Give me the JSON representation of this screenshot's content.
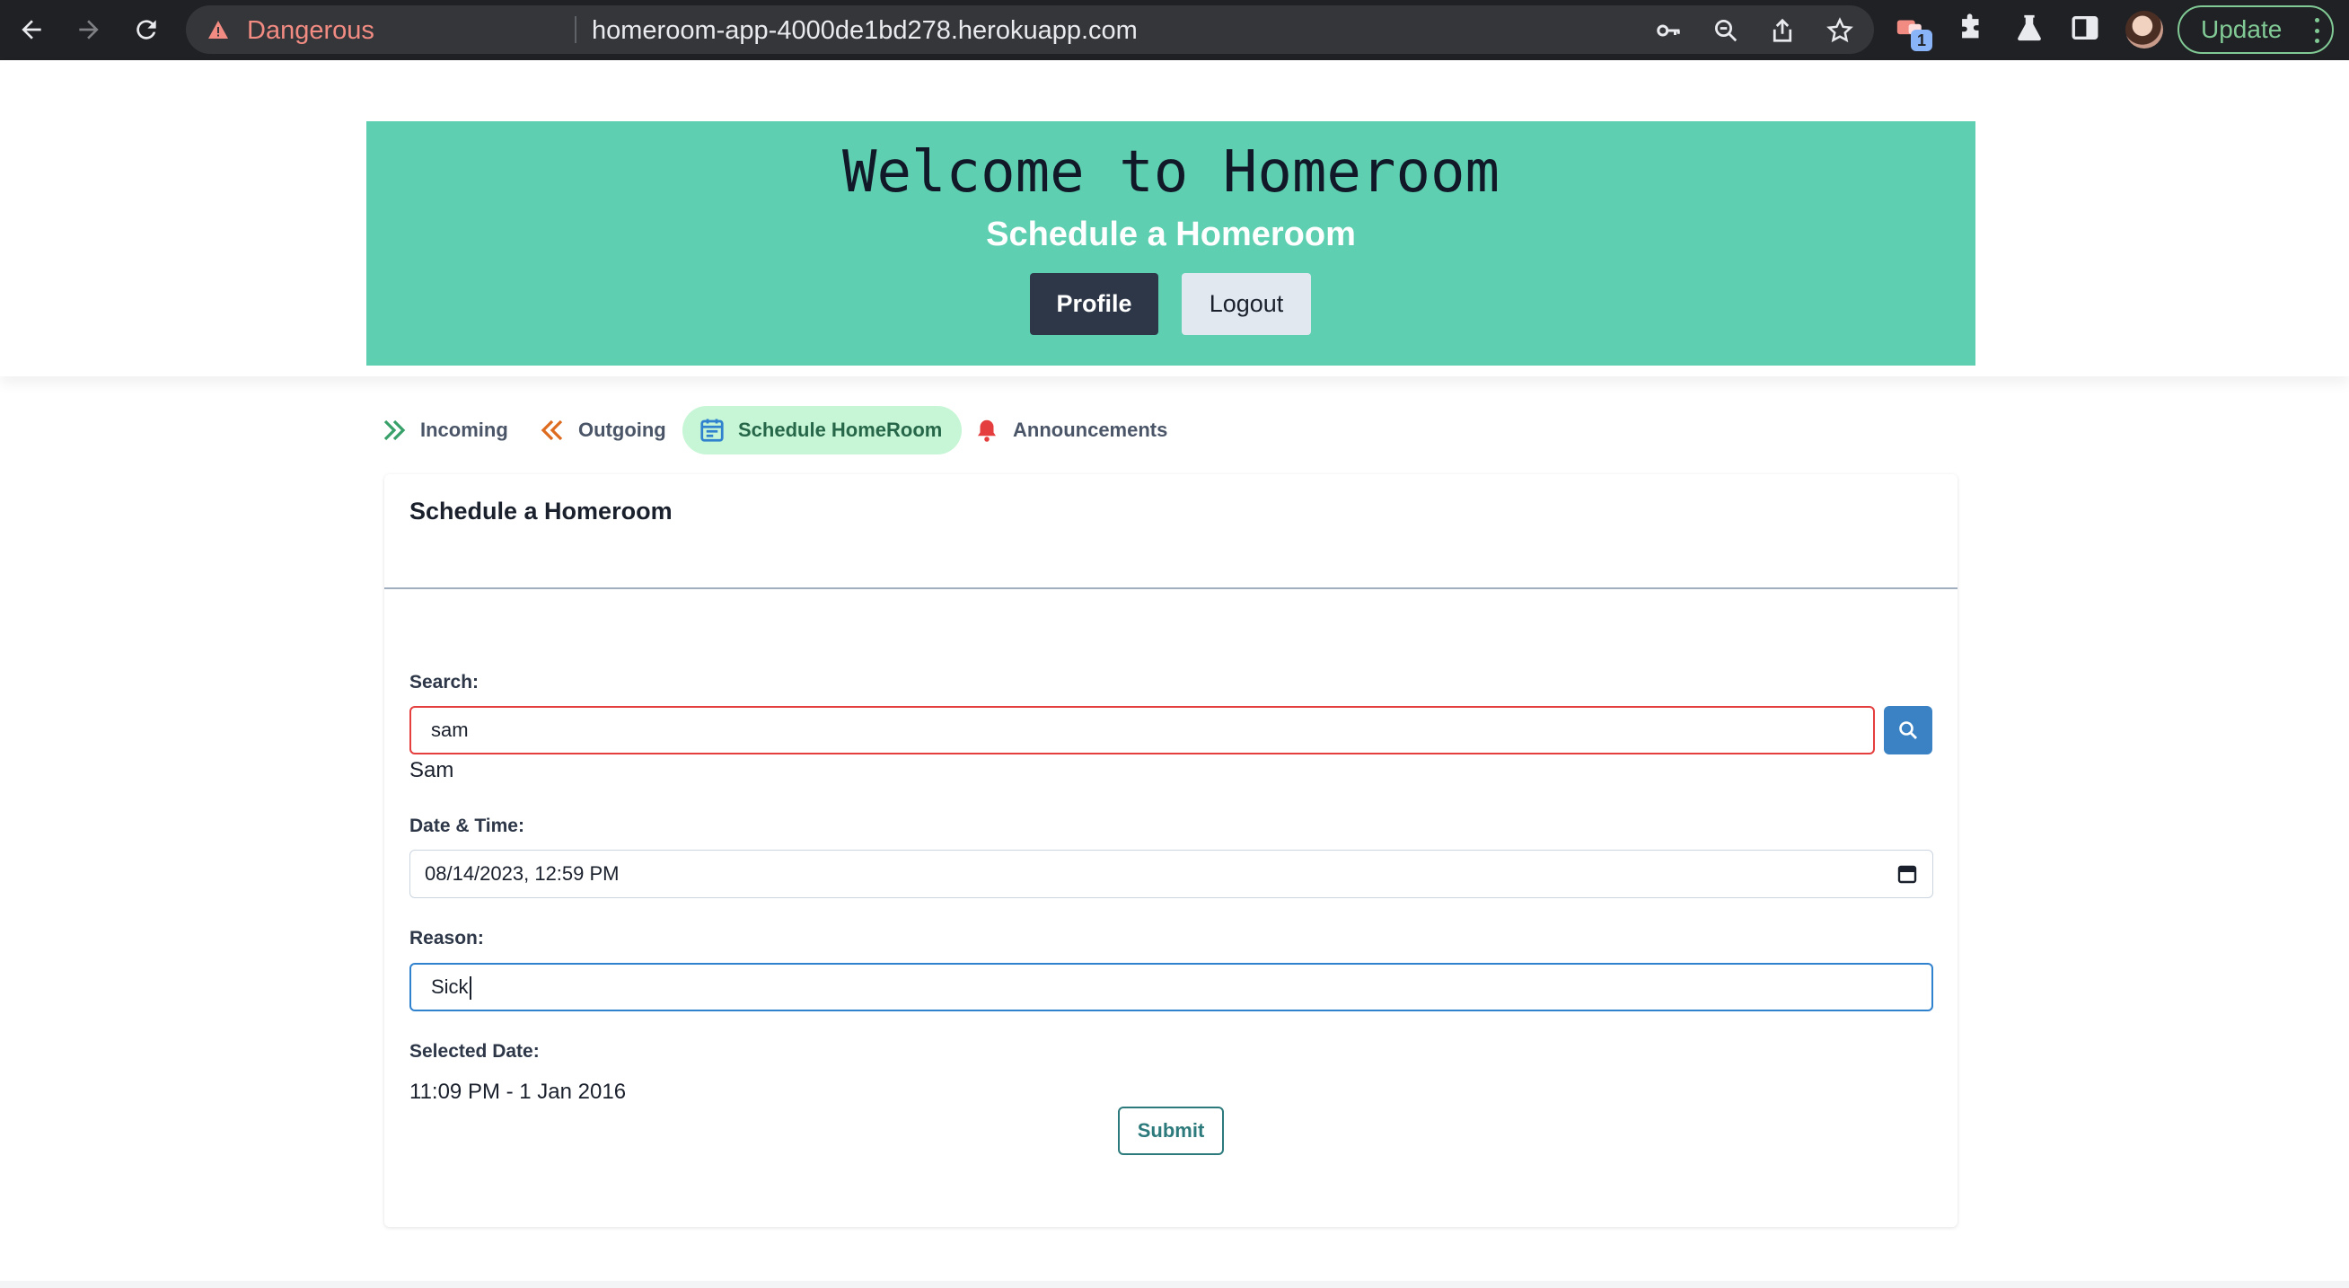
{
  "browser": {
    "security_label": "Dangerous",
    "url": "homeroom-app-4000de1bd278.herokuapp.com",
    "extension_badge": "1",
    "update_label": "Update"
  },
  "header": {
    "title": "Welcome to Homeroom",
    "subtitle": "Schedule a Homeroom",
    "profile_label": "Profile",
    "logout_label": "Logout",
    "colors": {
      "hero": "#5ecfb1",
      "profile_btn": "#2d3748",
      "logout_btn": "#e2e8f0"
    }
  },
  "tabs": [
    {
      "label": "Incoming",
      "icon": "double-chevron-right-icon",
      "color": "#38a169",
      "active": false
    },
    {
      "label": "Outgoing",
      "icon": "double-chevron-left-icon",
      "color": "#dd6b20",
      "active": false
    },
    {
      "label": "Schedule HomeRoom",
      "icon": "calendar-icon",
      "color": "#3182ce",
      "active": true
    },
    {
      "label": "Announcements",
      "icon": "bell-icon",
      "color": "#e53e3e",
      "active": false
    }
  ],
  "form": {
    "title": "Schedule a Homeroom",
    "search_label": "Search:",
    "search_value": "sam",
    "search_result": "Sam",
    "datetime_label": "Date & Time:",
    "datetime_value": "08/14/2023, 12:59 PM",
    "reason_label": "Reason:",
    "reason_value": "Sick",
    "selected_date_label": "Selected Date:",
    "selected_date_value": "11:09 PM - 1 Jan 2016",
    "submit_label": "Submit"
  }
}
